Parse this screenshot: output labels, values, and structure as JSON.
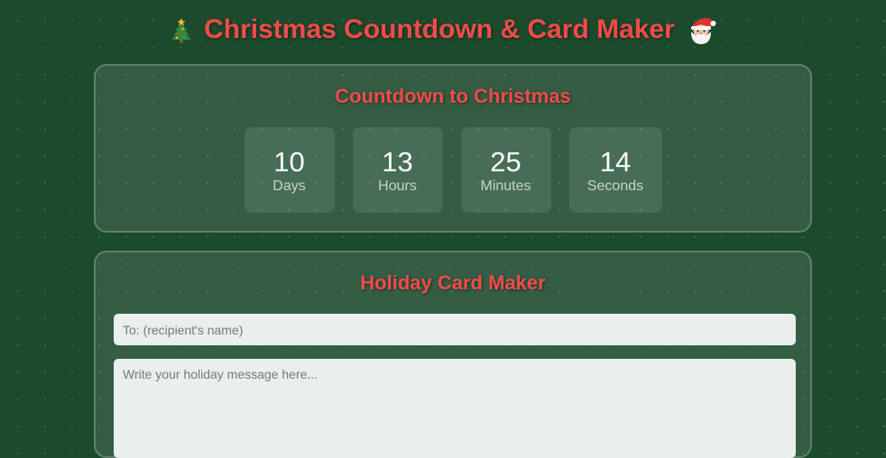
{
  "header": {
    "title": "Christmas Countdown & Card Maker",
    "left_icon": "christmas-tree",
    "right_icon": "santa-face"
  },
  "countdown": {
    "heading": "Countdown to Christmas",
    "units": [
      {
        "value": "10",
        "label": "Days"
      },
      {
        "value": "13",
        "label": "Hours"
      },
      {
        "value": "25",
        "label": "Minutes"
      },
      {
        "value": "14",
        "label": "Seconds"
      }
    ]
  },
  "card_maker": {
    "heading": "Holiday Card Maker",
    "recipient_placeholder": "To: (recipient's name)",
    "message_placeholder": "Write your holiday message here..."
  },
  "colors": {
    "background": "#1c4a2c",
    "accent_red": "#f24b4b"
  }
}
